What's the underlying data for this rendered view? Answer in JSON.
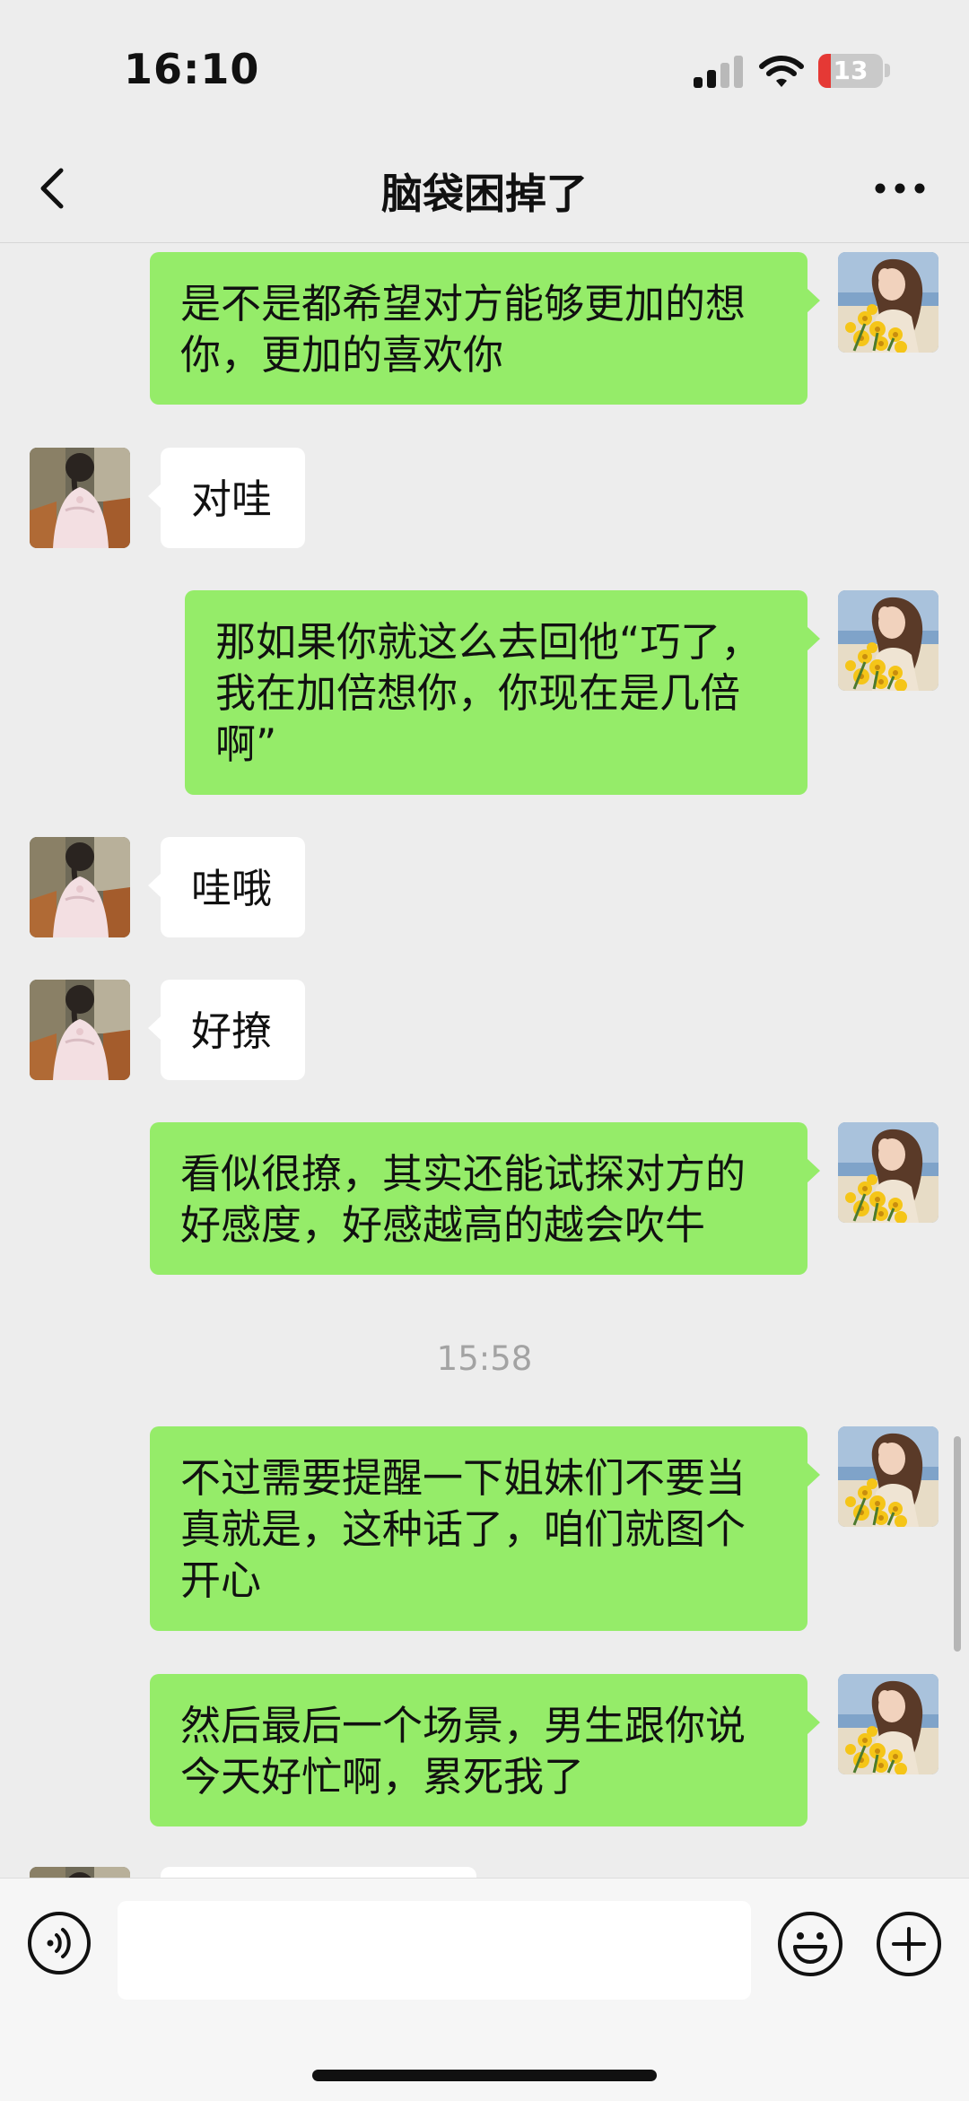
{
  "status_bar": {
    "time": "16:10",
    "battery": "13"
  },
  "header": {
    "title": "脑袋困掉了"
  },
  "chat": {
    "messages": [
      {
        "side": "right",
        "text": "是不是都希望对方能够更加的想\n你，更加的喜欢你"
      },
      {
        "side": "left",
        "text": "对哇"
      },
      {
        "side": "right",
        "text": "那如果你就这么去回他“巧了，\n我在加倍想你，你现在是几倍\n啊”"
      },
      {
        "side": "left",
        "text": "哇哦"
      },
      {
        "side": "left",
        "text": "好撩"
      },
      {
        "side": "right",
        "text": "看似很撩，其实还能试探对方的\n好感度，好感越高的越会吹牛"
      },
      {
        "side": "right",
        "text": "不过需要提醒一下姐妹们不要当\n真就是，这种话了，咱们就图个\n开心"
      },
      {
        "side": "right",
        "text": "然后最后一个场景，男生跟你说\n今天好忙啊，累死我了"
      }
    ],
    "timestamp": "15:58"
  },
  "input_bar": {
    "value": "",
    "placeholder": ""
  },
  "icons": {
    "back": "chevron-left-icon",
    "more": "more-dots-icon",
    "voice": "voice-icon",
    "emoji": "emoji-icon",
    "plus": "plus-icon"
  },
  "colors": {
    "background": "#ededed",
    "bubble_self": "#95ec69",
    "bubble_other": "#ffffff",
    "battery_low": "#e53935",
    "timestamp": "#a3a3a3"
  }
}
